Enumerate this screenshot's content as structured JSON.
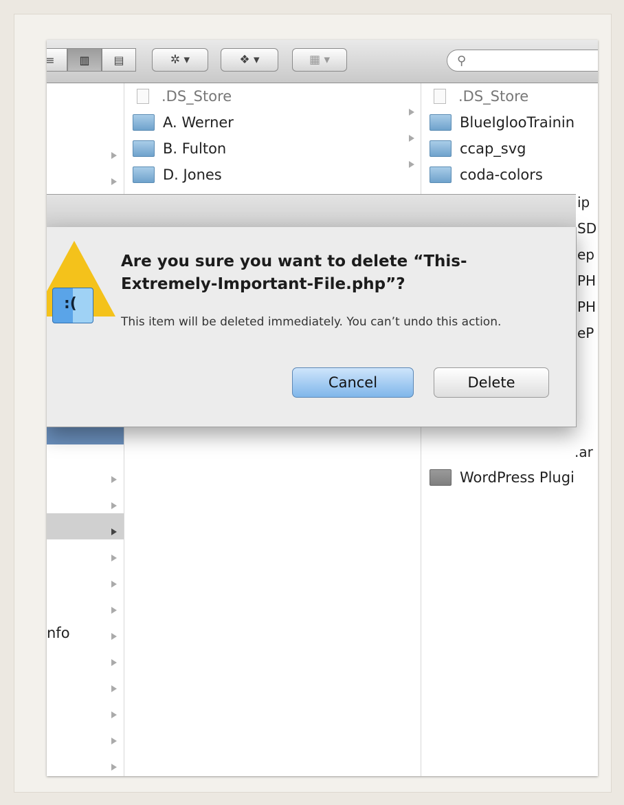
{
  "toolbar": {
    "action_icon": "gear-icon",
    "dropbox_icon": "dropbox-icon",
    "arrange_icon": "arrange-icon",
    "search_icon": "magnifier-icon",
    "search_value": "",
    "search_placeholder": ""
  },
  "column1": {
    "partial_label": "nfo",
    "selected_accent": "#6a8fbc"
  },
  "column2": {
    "items": [
      {
        "name": ".DS_Store",
        "type": "file"
      },
      {
        "name": "A. Werner",
        "type": "folder"
      },
      {
        "name": "B. Fulton",
        "type": "folder"
      },
      {
        "name": "D. Jones",
        "type": "folder"
      }
    ]
  },
  "column3": {
    "items": [
      {
        "name": ".DS_Store",
        "type": "file"
      },
      {
        "name": "BlueIglooTrainin",
        "type": "folder"
      },
      {
        "name": "ccap_svg",
        "type": "folder"
      },
      {
        "name": "coda-colors",
        "type": "folder"
      }
    ],
    "partial_right": [
      "ip",
      "SD",
      "ep",
      "PH",
      "PH",
      "eP"
    ],
    "partial_ar": ".ar",
    "wordpress_item": "WordPress Plugi"
  },
  "dialog": {
    "title": "Are you sure you want to delete “This-Extremely-Important-File.php”?",
    "message": "This item will be deleted immediately. You can’t undo this action.",
    "cancel_label": "Cancel",
    "delete_label": "Delete",
    "warning_icon": "caution-icon",
    "app_icon": "finder-icon"
  }
}
